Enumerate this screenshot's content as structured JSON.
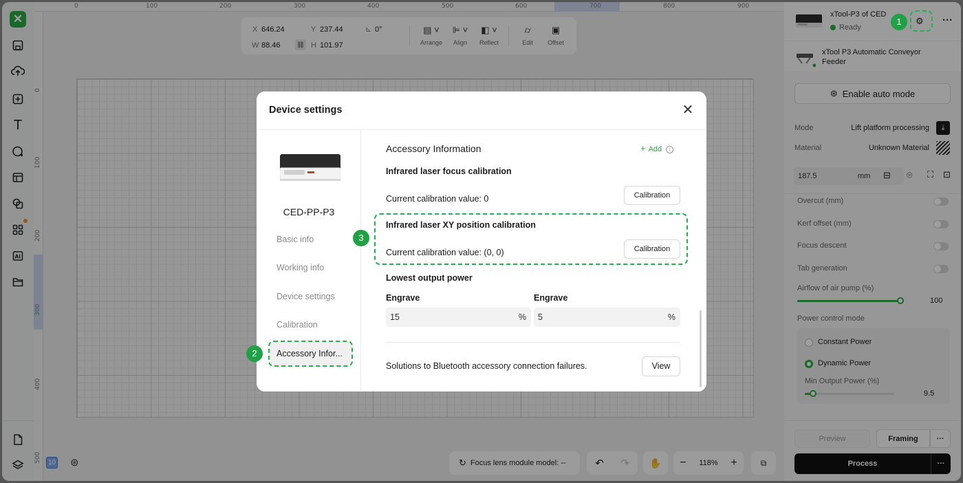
{
  "rulers": {
    "top": [
      "0",
      "100",
      "200",
      "300",
      "400",
      "500",
      "600",
      "700",
      "800",
      "900"
    ],
    "left": [
      "0",
      "100",
      "200",
      "300",
      "400",
      "500"
    ]
  },
  "canvas_toolbar": {
    "x_label": "X",
    "x_value": "646.24",
    "y_label": "Y",
    "y_value": "237.44",
    "w_label": "W",
    "w_value": "88.46",
    "h_label": "H",
    "h_value": "101.97",
    "rotation": "0°",
    "tools": [
      "Arrange",
      "Align",
      "Reflect",
      "Edit",
      "Offset"
    ]
  },
  "bottom_bar": {
    "layer_count": "10",
    "focus_lens": "Focus lens module model: --",
    "zoom": "118%"
  },
  "right_panel": {
    "device_name": "xTool-P3 of CED",
    "device_status": "Ready",
    "accessory_name": "xTool P3 Automatic Conveyor Feeder",
    "auto_mode_label": "Enable auto mode",
    "mode_label": "Mode",
    "mode_value": "Lift platform processing",
    "material_label": "Material",
    "material_value": "Unknown Material",
    "thickness_value": "187.5",
    "thickness_unit": "mm",
    "options": [
      "Overcut (mm)",
      "Kerf offset (mm)",
      "Focus descent",
      "Tab generation"
    ],
    "airflow_label": "Airflow of air pump (%)",
    "airflow_value": "100",
    "airflow_level": 1.0,
    "power_mode_label": "Power control mode",
    "power_modes": [
      "Constant Power",
      "Dynamic Power"
    ],
    "selected_power_mode": "Dynamic Power",
    "min_power_label": "Min Output Power (%)",
    "min_power_value": "9.5",
    "min_power_level": 0.095,
    "preview_label": "Preview",
    "framing_label": "Framing",
    "process_label": "Process"
  },
  "modal": {
    "title": "Device settings",
    "device_name": "CED-PP-P3",
    "nav": [
      "Basic info",
      "Working info",
      "Device settings",
      "Calibration"
    ],
    "nav_active": "Accessory Infor...",
    "section_title": "Accessory Information",
    "add_label": "Add",
    "ir_focus_title": "Infrared laser focus calibration",
    "ir_focus_value": "Current calibration value: 0",
    "ir_xy_title": "Infrared laser XY position calibration",
    "ir_xy_value": "Current calibration value: (0, 0)",
    "calibration_button": "Calibration",
    "lowest_power_title": "Lowest output power",
    "engrave_label_1": "Engrave",
    "engrave_value_1": "15",
    "engrave_label_2": "Engrave",
    "engrave_value_2": "5",
    "percent_unit": "%",
    "bluetooth_text": "Solutions to Bluetooth accessory connection failures.",
    "view_label": "View"
  },
  "annotations": {
    "step1": "1",
    "step2": "2",
    "step3": "3",
    "highlight_color": "#22b14c"
  }
}
